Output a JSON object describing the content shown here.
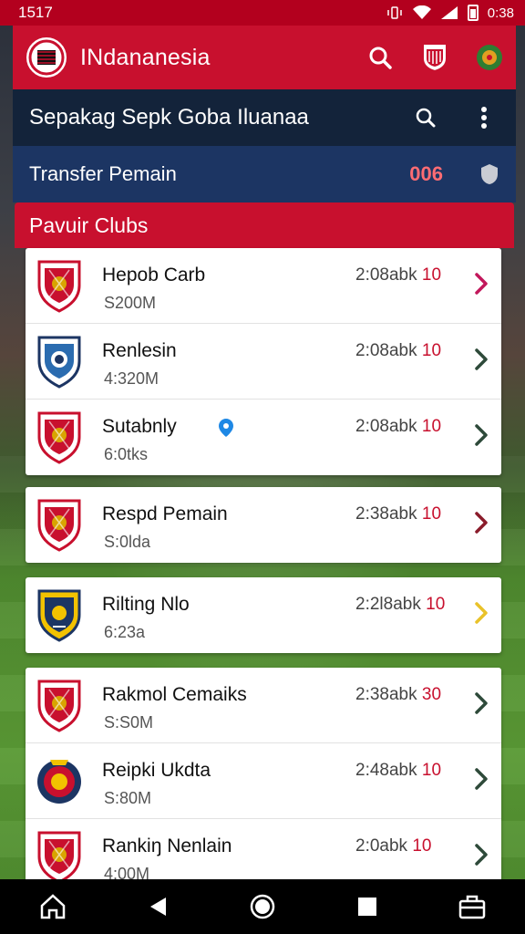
{
  "status_bar": {
    "time": "1517",
    "clock": "0:38"
  },
  "app_bar": {
    "title": "INdananesia"
  },
  "subheader": {
    "title": "Sepakag  Sepk Goba Iluanaa"
  },
  "transfer": {
    "label": "Transfer Pemain",
    "count": "006"
  },
  "section": {
    "title": "Pavuir Clubs"
  },
  "clubs": [
    {
      "name": "Hepob Carb",
      "value": "S200M",
      "time": "2:08abk",
      "time_accent": "10",
      "chevron_color": "#c2185b",
      "badge": "red"
    },
    {
      "name": "Renlesin",
      "value": "4:320M",
      "time": "2:08abk",
      "time_accent": "10",
      "chevron_color": "#2e4a3a",
      "badge": "blue"
    },
    {
      "name": "Sutabnly",
      "value": "6:0tks",
      "time": "2:08abk",
      "time_accent": "10",
      "chevron_color": "#2e4a3a",
      "badge": "red"
    },
    {
      "name": "Respd Pemain",
      "value": "S:0lda",
      "time": "2:38abk",
      "time_accent": "10",
      "chevron_color": "#8a1c2b",
      "badge": "red"
    },
    {
      "name": "Rilting Nlo",
      "value": "6:23a",
      "time": "2:2l8abk",
      "time_accent": "10",
      "chevron_color": "#e9c22a",
      "badge": "navy"
    },
    {
      "name": "Rakmol Cemaiks",
      "value": "S:S0M",
      "time": "2:38abk",
      "time_accent": "30",
      "chevron_color": "#2e4a3a",
      "badge": "red"
    },
    {
      "name": "Reipki Ukdta",
      "value": "S:80M",
      "time": "2:48abk",
      "time_accent": "10",
      "chevron_color": "#2e4a3a",
      "badge": "blue-round"
    },
    {
      "name": "Rankiŋ Nenlain",
      "value": "4:00M",
      "time": "2:0abk",
      "time_accent": "10",
      "chevron_color": "#2e4a3a",
      "badge": "red"
    }
  ],
  "colors": {
    "primary": "#c8102e",
    "dark_navy": "#13233a",
    "navy": "#1c3563",
    "accent_red": "#ff6c73"
  }
}
